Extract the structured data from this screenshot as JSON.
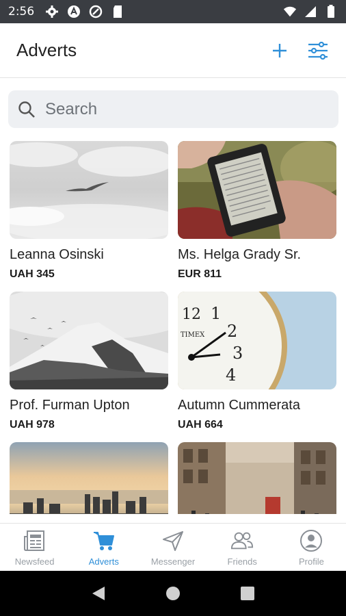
{
  "status_bar": {
    "time": "2:56",
    "icons": [
      "gear-icon",
      "a-badge-icon",
      "data-saver-icon",
      "sd-card-icon"
    ],
    "right_icons": [
      "wifi-icon",
      "signal-icon",
      "battery-icon"
    ]
  },
  "app_bar": {
    "title": "Adverts",
    "actions": [
      "add-icon",
      "filter-sliders-icon"
    ],
    "accent_color": "#2f8fd8"
  },
  "search": {
    "placeholder": "Search",
    "value": ""
  },
  "adverts": [
    {
      "name": "Leanna Osinski",
      "price": "UAH 345",
      "image": "bird-over-clouds"
    },
    {
      "name": "Ms. Helga Grady Sr.",
      "price": "EUR 811",
      "image": "hand-holding-ereader"
    },
    {
      "name": "Prof. Furman Upton",
      "price": "UAH 978",
      "image": "snowy-mountain-birds"
    },
    {
      "name": "Autumn Cummerata",
      "price": "UAH 664",
      "image": "pocket-watch-closeup"
    },
    {
      "name": "",
      "price": "",
      "image": "city-skyline-sunset"
    },
    {
      "name": "",
      "price": "",
      "image": "busy-city-street"
    }
  ],
  "bottom_nav": {
    "items": [
      {
        "label": "Newsfeed",
        "icon": "newspaper-icon",
        "active": false
      },
      {
        "label": "Adverts",
        "icon": "cart-icon",
        "active": true
      },
      {
        "label": "Messenger",
        "icon": "paper-plane-icon",
        "active": false
      },
      {
        "label": "Friends",
        "icon": "people-icon",
        "active": false
      },
      {
        "label": "Profile",
        "icon": "user-circle-icon",
        "active": false
      }
    ]
  },
  "system_nav": [
    "back-icon",
    "home-icon",
    "recents-icon"
  ]
}
